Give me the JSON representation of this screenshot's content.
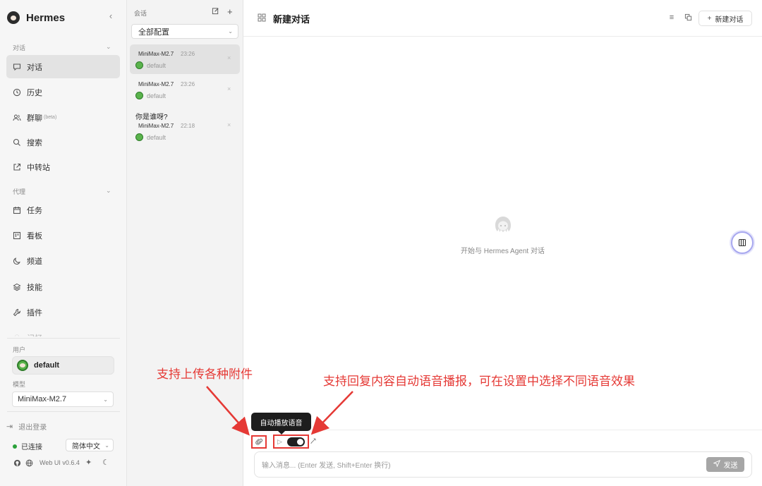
{
  "app": {
    "name": "Hermes"
  },
  "sidebar": {
    "section_chat": "对话",
    "section_agent": "代理",
    "items_chat": [
      {
        "label": "对话",
        "icon": "chat-bubble-icon",
        "active": true
      },
      {
        "label": "历史",
        "icon": "clock-icon"
      },
      {
        "label": "群聊",
        "sub": "(beta)",
        "icon": "users-icon"
      },
      {
        "label": "搜索",
        "icon": "search-icon"
      },
      {
        "label": "中转站",
        "icon": "external-link-icon"
      }
    ],
    "items_agent": [
      {
        "label": "任务",
        "icon": "calendar-icon"
      },
      {
        "label": "看板",
        "icon": "kanban-icon"
      },
      {
        "label": "频道",
        "icon": "moon-icon"
      },
      {
        "label": "技能",
        "icon": "layers-icon"
      },
      {
        "label": "插件",
        "icon": "wrench-icon"
      },
      {
        "label": "记忆",
        "icon": "memory-icon"
      }
    ],
    "user_label": "用户",
    "user_name": "default",
    "model_label": "模型",
    "model_value": "MiniMax-M2.7",
    "logout": "退出登录",
    "status": "已连接",
    "language": "简体中文",
    "version": "Web UI v0.6.4"
  },
  "conversations": {
    "title": "会话",
    "filter": "全部配置",
    "items": [
      {
        "question": "",
        "model": "MiniMax-M2.7",
        "time": "23:26",
        "profile": "default",
        "active": true
      },
      {
        "question": "",
        "model": "MiniMax-M2.7",
        "time": "23:26",
        "profile": "default"
      },
      {
        "question": "你是谁呀?",
        "model": "MiniMax-M2.7",
        "time": "22:18",
        "profile": "default"
      }
    ]
  },
  "main": {
    "title": "新建对话",
    "new_chat": "新建对话",
    "empty_text": "开始与 Hermes Agent 对话",
    "tooltip": "自动播放语音",
    "input_placeholder": "输入消息... (Enter 发送, Shift+Enter 换行)",
    "send": "发送"
  },
  "annotations": {
    "attach": "支持上传各种附件",
    "voice": "支持回复内容自动语音播报，可在设置中选择不同语音效果"
  },
  "colors": {
    "annotation": "#e53935",
    "status_ok": "#2aa13a",
    "toggle_on": "#1f1f1f"
  }
}
